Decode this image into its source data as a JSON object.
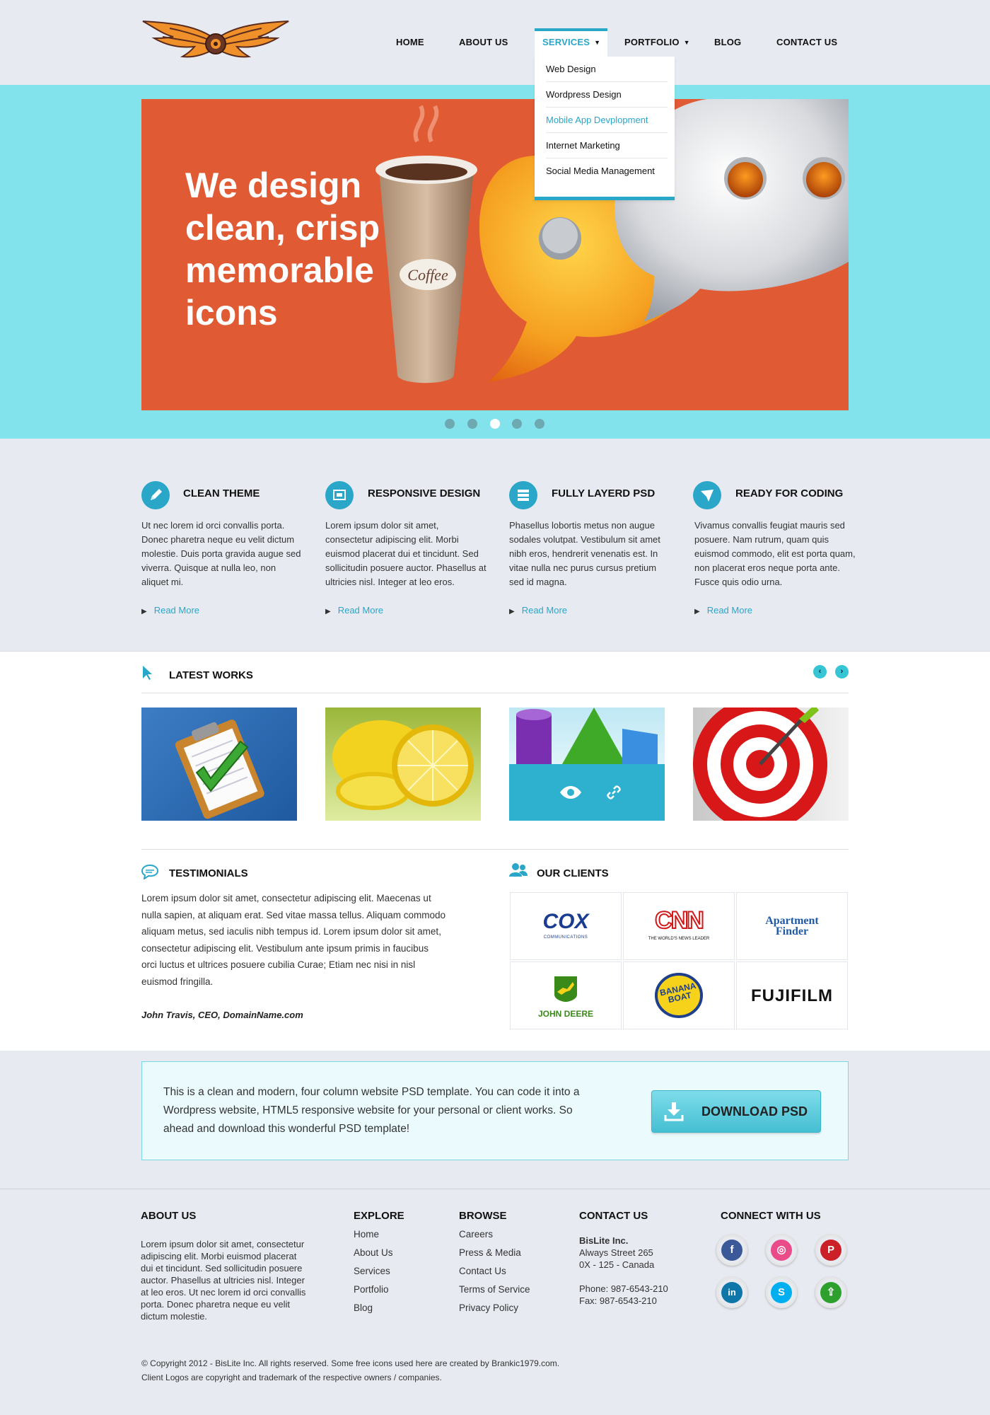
{
  "nav": {
    "items": [
      {
        "label": "HOME"
      },
      {
        "label": "ABOUT US"
      },
      {
        "label": "SERVICES"
      },
      {
        "label": "PORTFOLIO"
      },
      {
        "label": "BLOG"
      },
      {
        "label": "CONTACT US"
      }
    ],
    "active": "SERVICES",
    "dropdown": [
      "Web Design",
      "Wordpress Design",
      "Mobile App Devplopment",
      "Internet Marketing",
      "Social Media Management"
    ],
    "dropdown_highlighted": "Mobile App Devplopment"
  },
  "hero": {
    "headline": "We design clean, crisp & memorable icons",
    "cup_label": "Coffee",
    "slides": 5,
    "current_slide": 3
  },
  "features": [
    {
      "icon": "pencil-icon",
      "title": "CLEAN THEME",
      "text": "Ut nec lorem id orci convallis porta. Donec pharetra neque eu velit dictum molestie. Duis porta gravida augue sed viverra. Quisque at nulla leo, non aliquet mi.",
      "link": "Read More"
    },
    {
      "icon": "responsive-icon",
      "title": "RESPONSIVE DESIGN",
      "text": "Lorem ipsum dolor sit amet, consectetur adipiscing elit. Morbi euismod placerat dui et tincidunt. Sed sollicitudin posuere auctor. Phasellus at ultricies nisl. Integer at leo eros.",
      "link": "Read More"
    },
    {
      "icon": "layers-icon",
      "title": "FULLY LAYERD PSD",
      "text": " Phasellus lobortis metus non augue sodales volutpat. Vestibulum sit amet nibh eros, hendrerit venenatis est. In vitae nulla nec purus cursus pretium sed id magna.",
      "link": "Read More"
    },
    {
      "icon": "paper-plane-icon",
      "title": "READY FOR CODING",
      "text": "Vivamus convallis feugiat mauris sed posuere. Nam rutrum, quam quis euismod commodo, elit est porta quam, non placerat eros neque porta ante. Fusce quis odio urna.",
      "link": "Read More"
    }
  ],
  "latest_works": {
    "title": "LATEST WORKS",
    "items": [
      "clipboard-icon",
      "lemon-icon",
      "shapes-icon",
      "target-icon"
    ]
  },
  "testimonials": {
    "title": "TESTIMONIALS",
    "text": "Lorem ipsum dolor sit amet, consectetur adipiscing elit. Maecenas ut nulla sapien, at aliquam erat. Sed vitae massa tellus. Aliquam commodo aliquam metus, sed iaculis nibh tempus id. Lorem ipsum dolor sit amet, consectetur adipiscing elit. Vestibulum ante ipsum primis in faucibus orci luctus et ultrices posuere cubilia Curae; Etiam nec nisi in nisl euismod fringilla.",
    "author": "John Travis, CEO, DomainName.com"
  },
  "clients": {
    "title": "OUR CLIENTS",
    "logos": [
      {
        "name": "COX",
        "sub": "COMMUNICATIONS"
      },
      {
        "name": "CNN",
        "sub": "THE WORLD'S NEWS LEADER"
      },
      {
        "name": "Apartment Finder"
      },
      {
        "name": "JOHN DEERE"
      },
      {
        "name": "BANANA BOAT"
      },
      {
        "name": "FUJIFILM"
      }
    ]
  },
  "cta": {
    "text": "This is a clean and modern, four column website PSD template. You can code it into a Wordpress website, HTML5 responsive website for your personal or client works. So ahead and download this wonderful PSD template!",
    "button": "DOWNLOAD PSD"
  },
  "footer": {
    "about": {
      "title": "ABOUT US",
      "text": "Lorem ipsum dolor sit amet, consectetur adipiscing elit. Morbi euismod placerat dui et tincidunt. Sed sollicitudin posuere auctor. Phasellus at ultricies nisl. Integer at leo eros. Ut nec lorem id orci convallis porta. Donec pharetra neque eu velit dictum molestie."
    },
    "explore": {
      "title": "EXPLORE",
      "links": [
        "Home",
        "About Us",
        "Services",
        "Portfolio",
        "Blog"
      ]
    },
    "browse": {
      "title": "BROWSE",
      "links": [
        "Careers",
        "Press & Media",
        "Contact Us",
        "Terms of Service",
        "Privacy Policy"
      ]
    },
    "contact": {
      "title": "CONTACT US",
      "company": "BisLite Inc.",
      "street": "Always Street 265",
      "city": "0X - 125 - Canada",
      "phone": "Phone: 987-6543-210",
      "fax": "Fax: 987-6543-210"
    },
    "connect": {
      "title": "CONNECT WITH US",
      "networks": [
        "facebook",
        "dribbble",
        "pinterest",
        "linkedin",
        "skype",
        "share"
      ]
    },
    "copyright_1": "© Copyright 2012 - BisLite Inc. All rights reserved. Some free icons used here are created by Brankic1979.com.",
    "copyright_2": "Client Logos are copyright and trademark of the respective owners / companies."
  },
  "colors": {
    "accent": "#2aa6c8",
    "hero_band": "#82e3ed",
    "slide_bg": "#e05a34",
    "page_bg": "#e8eaf2"
  }
}
